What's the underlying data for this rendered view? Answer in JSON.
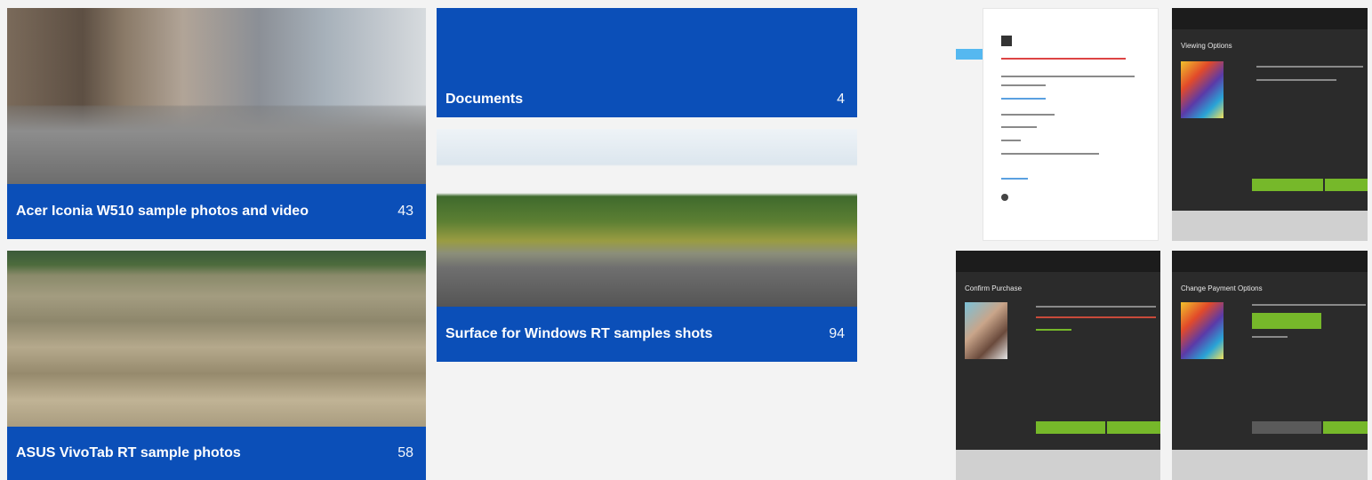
{
  "tiles": [
    {
      "title": "Acer Iconia W510 sample photos and video",
      "count": "43"
    },
    {
      "title": "ASUS VivoTab RT sample photos",
      "count": "58"
    },
    {
      "title": "Documents",
      "count": "4"
    },
    {
      "title": "Surface for Windows RT samples shots",
      "count": "94"
    }
  ],
  "screens": {
    "viewing_options": "Viewing Options",
    "confirm_purchase": "Confirm Purchase",
    "change_payment": "Change Payment Options"
  },
  "colors": {
    "accent": "#0b4fb8",
    "green": "#76b82a",
    "dark": "#2b2b2b",
    "pointer": "#55b8f0"
  }
}
